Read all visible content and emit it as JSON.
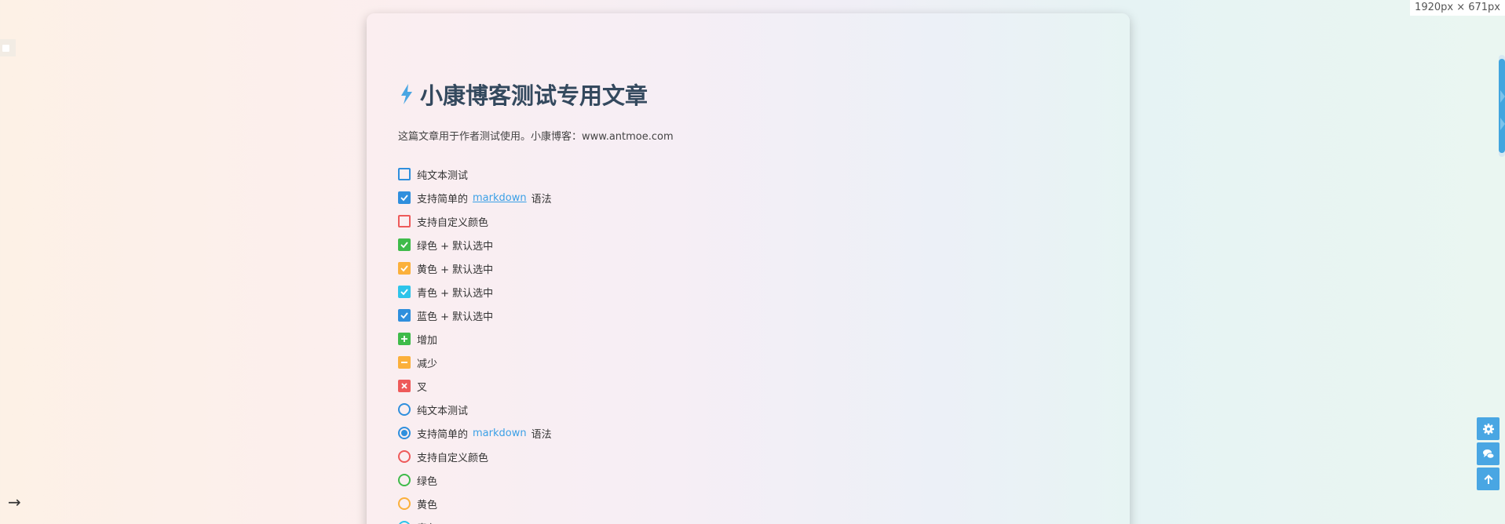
{
  "dim_badge": "1920px × 671px",
  "post": {
    "title": "小康博客测试专用文章",
    "description": "这篇文章用于作者测试使用。小康博客：www.antmoe.com"
  },
  "checkbox_items": [
    {
      "pre": "纯文本测试",
      "link": "",
      "post": "",
      "color": "#2f8fdd",
      "state": "empty"
    },
    {
      "pre": "支持简单的",
      "link": "markdown",
      "post": "语法",
      "color": "#2f8fdd",
      "state": "checked"
    },
    {
      "pre": "支持自定义颜色",
      "link": "",
      "post": "",
      "color": "#ee5a5a",
      "state": "empty"
    },
    {
      "pre": "绿色 + 默认选中",
      "link": "",
      "post": "",
      "color": "#3fbb4a",
      "state": "checked"
    },
    {
      "pre": "黄色 + 默认选中",
      "link": "",
      "post": "",
      "color": "#fbb03b",
      "state": "checked"
    },
    {
      "pre": "青色 + 默认选中",
      "link": "",
      "post": "",
      "color": "#2ec4ea",
      "state": "checked"
    },
    {
      "pre": "蓝色 + 默认选中",
      "link": "",
      "post": "",
      "color": "#2f8fdd",
      "state": "checked"
    },
    {
      "pre": "增加",
      "link": "",
      "post": "",
      "color": "#3fbb4a",
      "state": "plus"
    },
    {
      "pre": "减少",
      "link": "",
      "post": "",
      "color": "#fbb03b",
      "state": "minus"
    },
    {
      "pre": "叉",
      "link": "",
      "post": "",
      "color": "#ee5a5a",
      "state": "times"
    }
  ],
  "radio_items": [
    {
      "pre": "纯文本测试",
      "link": "",
      "post": "",
      "color": "#2f8fdd",
      "checked": false
    },
    {
      "pre": "支持简单的",
      "link": "markdown",
      "post": "语法",
      "color": "#2f8fdd",
      "checked": true
    },
    {
      "pre": "支持自定义颜色",
      "link": "",
      "post": "",
      "color": "#ee5a5a",
      "checked": false
    },
    {
      "pre": "绿色",
      "link": "",
      "post": "",
      "color": "#3fbb4a",
      "checked": false
    },
    {
      "pre": "黄色",
      "link": "",
      "post": "",
      "color": "#fbb03b",
      "checked": false
    },
    {
      "pre": "青色",
      "link": "",
      "post": "",
      "color": "#2ec4ea",
      "checked": false
    }
  ],
  "side_buttons": [
    "gear-icon",
    "chat-icon",
    "arrow-up-icon"
  ],
  "colors": {
    "accent": "#49a6e3",
    "title": "#34495e"
  }
}
